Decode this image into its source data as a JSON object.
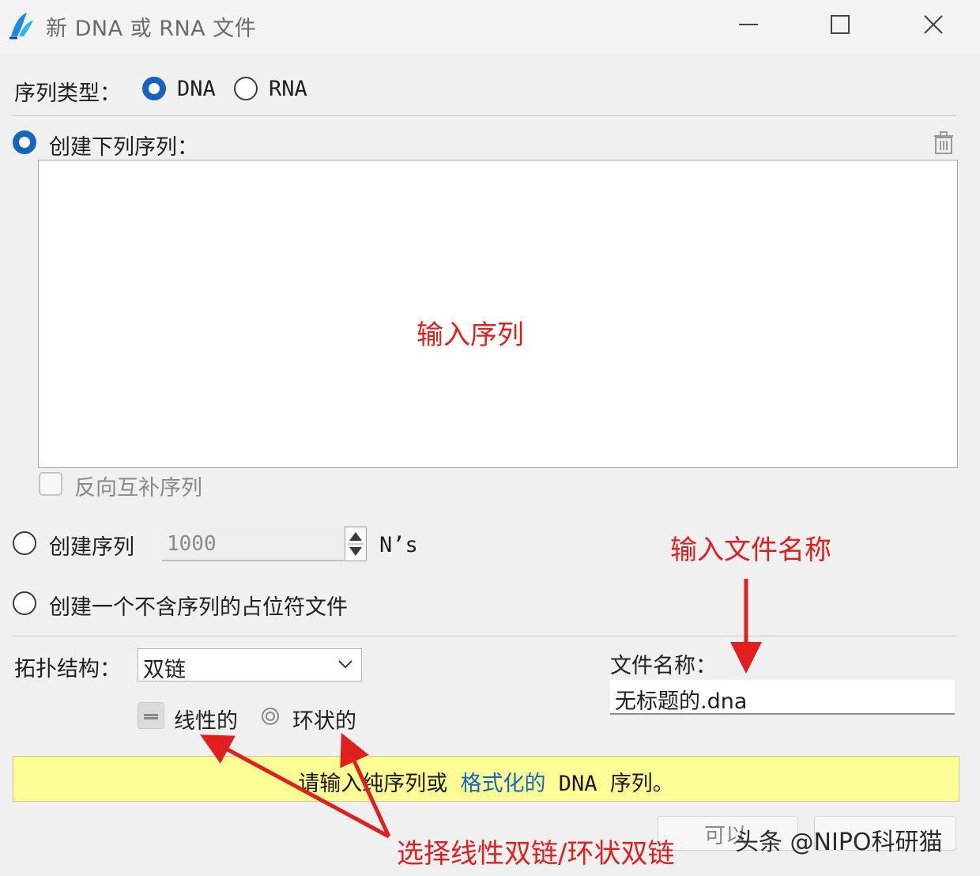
{
  "window": {
    "title": "新 DNA 或 RNA 文件"
  },
  "sequence_type": {
    "label": "序列类型：",
    "options": [
      {
        "label": "DNA",
        "selected": true
      },
      {
        "label": "RNA",
        "selected": false
      }
    ]
  },
  "create_sequence": {
    "label": "创建下列序列：",
    "selected": true,
    "textarea_value": "",
    "reverse_complement_label": "反向互补序列",
    "reverse_complement_checked": false
  },
  "create_n_sequence": {
    "label": "创建序列",
    "selected": false,
    "value": "1000",
    "unit": "N’s"
  },
  "create_placeholder": {
    "label": "创建一个不含序列的占位符文件",
    "selected": false
  },
  "topology": {
    "label": "拓扑结构：",
    "selected_value": "双链",
    "linear_label": "线性的",
    "circular_label": "环状的"
  },
  "file_name": {
    "label": "文件名称：",
    "value": "无标题的.dna"
  },
  "banner": {
    "text_before": "请输入纯序列或",
    "link_text": "格式化的",
    "text_after": " DNA 序列。",
    "color": "#fdfd96"
  },
  "annotations": {
    "input_sequence": "输入序列",
    "input_file_name": "输入文件名称",
    "select_topology": "选择线性双链/环状双链",
    "color": "#e01f1f"
  },
  "footer": {
    "partial_text": "可以"
  },
  "watermark": "头条 @NIPO科研猫",
  "colors": {
    "accent": "#1565c0",
    "background": "#f0f0f0"
  }
}
